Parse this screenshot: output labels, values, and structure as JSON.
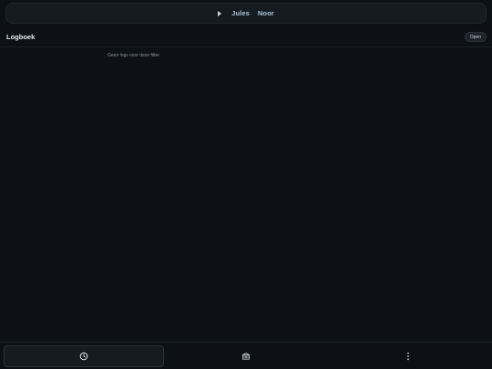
{
  "banner": {
    "players": [
      "Jules",
      "Noor"
    ],
    "icon": "play-icon"
  },
  "header": {
    "title": "Logboek",
    "open_label": "Open"
  },
  "log": {
    "empty_text": "Geen logs voor deze filter."
  },
  "bottom_nav": {
    "tabs": [
      {
        "icon": "clock-icon",
        "active": true
      },
      {
        "icon": "bank-icon",
        "active": false
      },
      {
        "icon": "more-vertical-icon",
        "active": false
      }
    ]
  },
  "colors": {
    "background": "#0d1117",
    "surface": "#161b22",
    "player_name": "#a9c4dd"
  }
}
